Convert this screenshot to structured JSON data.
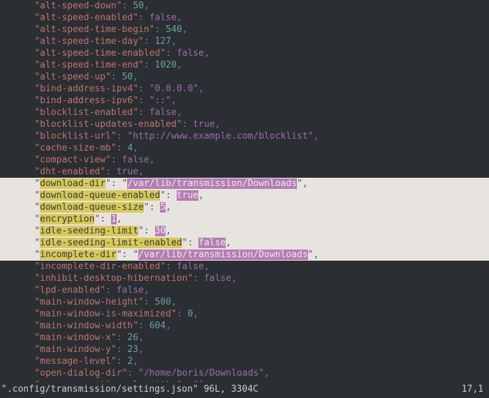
{
  "cursor_line": 17,
  "cursor_col": 1,
  "status_left": "\".config/transmission/settings.json\" 96L, 3304C",
  "status_right": "17,1",
  "highlight_start": 14,
  "highlight_end": 20,
  "entries": [
    {
      "key": "alt-speed-down",
      "type": "num",
      "value": 50
    },
    {
      "key": "alt-speed-enabled",
      "type": "bool",
      "value": false
    },
    {
      "key": "alt-speed-time-begin",
      "type": "num",
      "value": 540
    },
    {
      "key": "alt-speed-time-day",
      "type": "num",
      "value": 127
    },
    {
      "key": "alt-speed-time-enabled",
      "type": "bool",
      "value": false
    },
    {
      "key": "alt-speed-time-end",
      "type": "num",
      "value": 1020
    },
    {
      "key": "alt-speed-up",
      "type": "num",
      "value": 50
    },
    {
      "key": "bind-address-ipv4",
      "type": "str",
      "value": "0.0.0.0"
    },
    {
      "key": "bind-address-ipv6",
      "type": "str",
      "value": "::"
    },
    {
      "key": "blocklist-enabled",
      "type": "bool",
      "value": false
    },
    {
      "key": "blocklist-updates-enabled",
      "type": "bool",
      "value": true
    },
    {
      "key": "blocklist-url",
      "type": "str",
      "value": "http://www.example.com/blocklist"
    },
    {
      "key": "cache-size-mb",
      "type": "num",
      "value": 4
    },
    {
      "key": "compact-view",
      "type": "bool",
      "value": false
    },
    {
      "key": "dht-enabled",
      "type": "bool",
      "value": true
    },
    {
      "key": "download-dir",
      "type": "str",
      "value": "/var/lib/transmission/Downloads"
    },
    {
      "key": "download-queue-enabled",
      "type": "bool",
      "value": true
    },
    {
      "key": "download-queue-size",
      "type": "num",
      "value": 5
    },
    {
      "key": "encryption",
      "type": "num",
      "value": 1
    },
    {
      "key": "idle-seeding-limit",
      "type": "num",
      "value": 30
    },
    {
      "key": "idle-seeding-limit-enabled",
      "type": "bool",
      "value": false
    },
    {
      "key": "incomplete-dir",
      "type": "str",
      "value": "/var/lib/transmission/Downloads"
    },
    {
      "key": "incomplete-dir-enabled",
      "type": "bool",
      "value": false
    },
    {
      "key": "inhibit-desktop-hibernation",
      "type": "bool",
      "value": false
    },
    {
      "key": "lpd-enabled",
      "type": "bool",
      "value": false
    },
    {
      "key": "main-window-height",
      "type": "num",
      "value": 500
    },
    {
      "key": "main-window-is-maximized",
      "type": "num",
      "value": 0
    },
    {
      "key": "main-window-width",
      "type": "num",
      "value": 604
    },
    {
      "key": "main-window-x",
      "type": "num",
      "value": 26
    },
    {
      "key": "main-window-y",
      "type": "num",
      "value": 23
    },
    {
      "key": "message-level",
      "type": "num",
      "value": 2
    },
    {
      "key": "open-dialog-dir",
      "type": "str",
      "value": "/home/boris/Downloads"
    },
    {
      "key": "peer-congestion-algorithm",
      "type": "str",
      "value": ""
    }
  ]
}
